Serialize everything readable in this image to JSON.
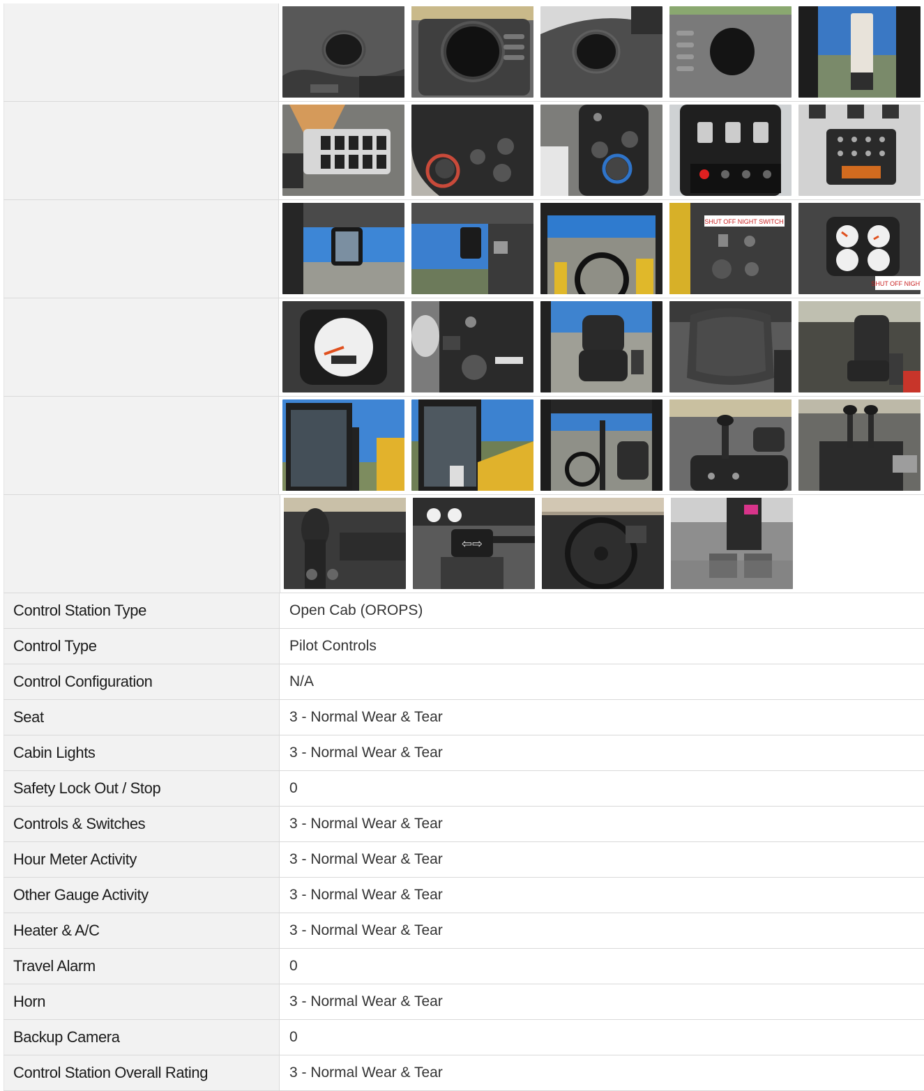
{
  "photo_rows": [
    [
      "dash-panel-cupholder-1",
      "dash-panel-cupholder-2",
      "dash-panel-cupholder-3",
      "dash-panel-cupholder-4",
      "cab-pillar-light"
    ],
    [
      "switch-panel",
      "climate-knob-panel",
      "climate-knob-panel-2",
      "indicator-switch-panel",
      "warning-light-display"
    ],
    [
      "cab-interior-mirror",
      "cab-interior-mirror-2",
      "front-windshield-view",
      "shutoff-key-panel",
      "gauge-cluster"
    ],
    [
      "speedometer-gauge",
      "key-switch-console",
      "operator-seat",
      "operator-seat-closeup",
      "operator-seat-side"
    ],
    [
      "cab-door-exterior",
      "cab-door-interior",
      "cab-interior-wide",
      "pilot-joystick",
      "pilot-joystick-2"
    ],
    [
      "steering-column-lever",
      "turn-signal-lever",
      "steering-wheel",
      "floor-pedals"
    ]
  ],
  "specs": [
    {
      "label": "Control Station Type",
      "value": "Open Cab (OROPS)"
    },
    {
      "label": "Control Type",
      "value": "Pilot Controls"
    },
    {
      "label": "Control Configuration",
      "value": "N/A"
    },
    {
      "label": "Seat",
      "value": "3 - Normal Wear & Tear"
    },
    {
      "label": "Cabin Lights",
      "value": "3 - Normal Wear & Tear"
    },
    {
      "label": "Safety Lock Out / Stop",
      "value": "0"
    },
    {
      "label": "Controls & Switches",
      "value": "3 - Normal Wear & Tear"
    },
    {
      "label": "Hour Meter Activity",
      "value": "3 - Normal Wear & Tear"
    },
    {
      "label": "Other Gauge Activity",
      "value": "3 - Normal Wear & Tear"
    },
    {
      "label": "Heater & A/C",
      "value": "3 - Normal Wear & Tear"
    },
    {
      "label": "Travel Alarm",
      "value": "0"
    },
    {
      "label": "Horn",
      "value": "3 - Normal Wear & Tear"
    },
    {
      "label": "Backup Camera",
      "value": "0"
    },
    {
      "label": "Control Station Overall Rating",
      "value": "3 - Normal Wear & Tear"
    }
  ],
  "photo_text": {
    "shutoff_label": "SHUT OFF NIGHT SWITCH",
    "shutoff_label_2": "SHUT OFF NIGHT"
  }
}
